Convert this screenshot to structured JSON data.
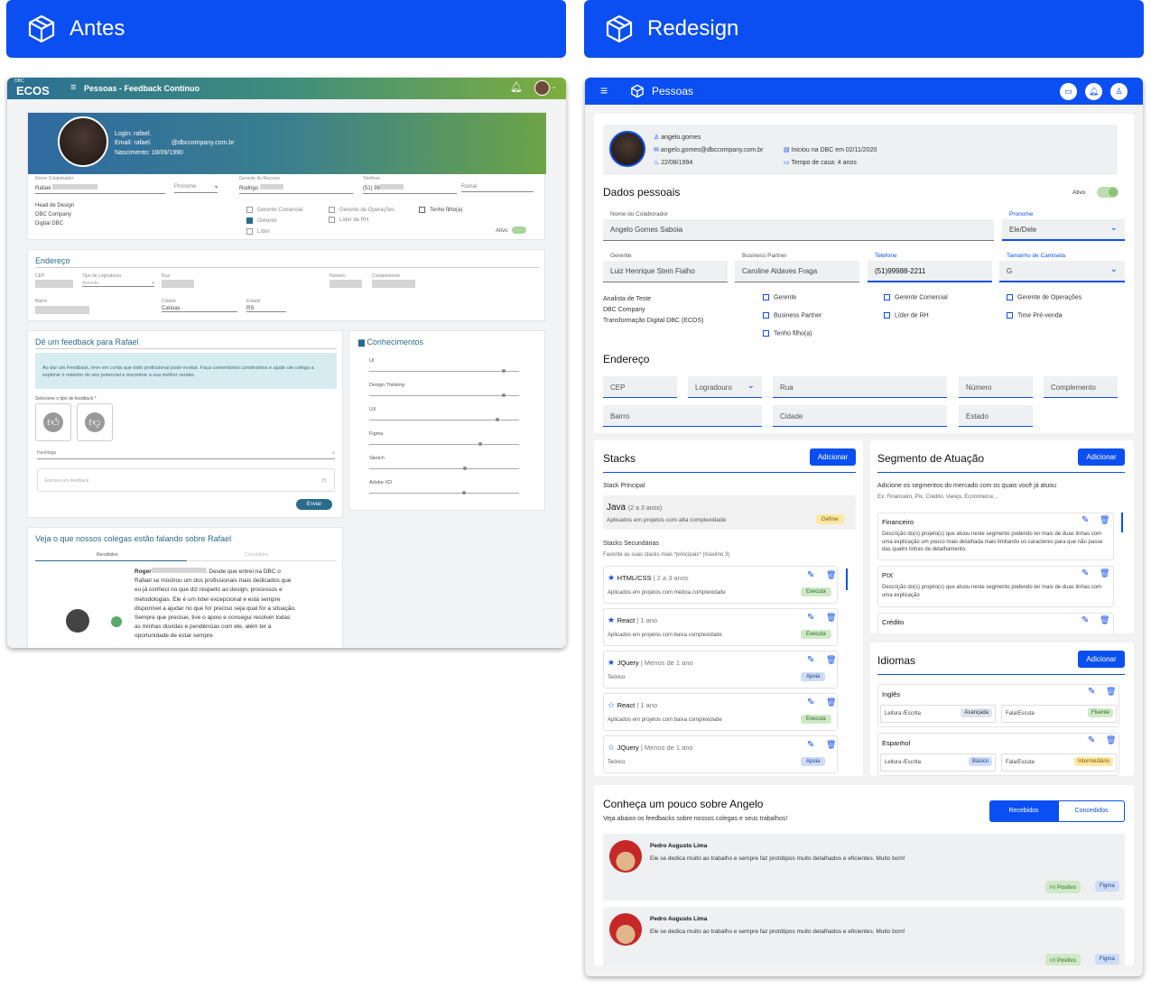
{
  "banner_left": "Antes",
  "banner_right": "Redesign",
  "old": {
    "header_title": "Pessoas - Feedback Contínuo",
    "logo_top": "DBC",
    "logo": "ECOS",
    "login": "Login: rafael.",
    "email": "Email: rafael.",
    "email_end": "@dbccompany.com.br",
    "birth": "Nascimento: 18/09/1990",
    "f_name_lbl": "Nome Colaborador",
    "f_name": "Rafael",
    "f_pron": "Pronome",
    "f_mgr_lbl": "Gerente do Recurso",
    "f_mgr": "Rodrigo",
    "f_tel_lbl": "Telefone",
    "f_tel": "(51) 99",
    "f_ramal": "Ramal",
    "roles": [
      "Head de Design",
      "DBC Company",
      "Digital DBC"
    ],
    "cb1": "Gerente Comercial",
    "cb2": "Gerente",
    "cb3": "Líder",
    "cb4": "Gerente de Operações",
    "cb5": "Líder de RH",
    "cb6": "Tenho filho(a)",
    "ativo": "Ativo",
    "end_title": "Endereço",
    "cep": "CEP",
    "tipo": "Tipo de Logradouro",
    "avenida": "Avenida",
    "rua": "Rua",
    "numero": "Número",
    "compl": "Complemento",
    "bairro": "Bairro",
    "cidade_lbl": "Cidade",
    "cidade": "Canoas",
    "estado_lbl": "Estado",
    "estado": "RS",
    "fb_title": "Dê um feedback para Rafael",
    "fb_info": "Ao dar um Feedback, leve em conta que todo profissional pode evoluir. Faça comentários construtivos e ajude um colega a explorar o máximo do seu potencial e encontrar a sua melhor versão.",
    "fb_type": "Selecione o tipo de feedback *",
    "hashtags": "Hashtags",
    "fb_ph": "Escreva um feedback",
    "send": "Enviar",
    "con_title": "Conhecimentos",
    "skills": [
      "UI",
      "Design Thinking",
      "UX",
      "Figma",
      "Sketch",
      "Adobe XD"
    ],
    "col_title": "Veja o que nossos colegas estão falando sobre Rafael",
    "tab_r": "Recebidos",
    "tab_c": "Concedidos",
    "author": "Roger",
    "quote": ": Desde que entrei na DBC o Rafael se mostrou um dos profissionais mais dedicados que eu já conheci no que diz respeito ao design, processos e metodologias. Ele é um líder excepcional e está sempre disponível a ajudar no que for preciso seja qual for a situação. Sempre que precisei, tive o apoio e consegui resolver todas as minhas dúvidas e pendências com ele, além ter a oportunidade de estar sempre"
  },
  "new": {
    "header_title": "Pessoas",
    "user": "angelo.gomes",
    "email": "angelo.gomes@dbccompany.com.br",
    "birth": "22/08/1994",
    "start": "Iniciou na DBC em 02/11/2020",
    "tenure": "Tempo de casa: 4 anos",
    "dp_title": "Dados pessoais",
    "ativo": "Ativo",
    "name_lbl": "Nome do Colaborador",
    "name": "Angelo Gomes Saboia",
    "pron_lbl": "Pronome",
    "pron": "Ele/Dele",
    "mgr_lbl": "Gerente",
    "mgr": "Luiz Henrique Stein Fialho",
    "bp_lbl": "Business Partner",
    "bp": "Caroline Aldaves Fraga",
    "tel_lbl": "Telefone",
    "tel": "(51)99988-2211",
    "shirt_lbl": "Tamanho de Camiseta",
    "shirt": "G",
    "roles": [
      "Analista de Teste",
      "DBC Company",
      "Transformação Digital DBC (ECOS)"
    ],
    "cbs": [
      "Gerente",
      "Gerente Comercial",
      "Gerente de Operações",
      "Business Partner",
      "Líder de RH",
      "Time Pré-venda",
      "Tenho filho(a)"
    ],
    "end_title": "Endereço",
    "cep": "CEP",
    "logr": "Logradouro",
    "rua": "Rua",
    "numero": "Número",
    "compl": "Complemento",
    "bairro": "Bairro",
    "cidade": "Cidade",
    "estado": "Estado",
    "stacks_title": "Stacks",
    "add": "Adicionar",
    "stack_main": "Stack Principal",
    "java": "Java",
    "java_time": "(2 a 3 anos)",
    "java_desc": "Aplicados em projetos com alta complexidade",
    "define": "Define",
    "stack_sec": "Stacks Secundárias",
    "stack_sec_sub": "Favorite as suas stacks mais *principais* (máximo 3)",
    "stacks": [
      {
        "name": "HTML/CSS",
        "time": "2 a 3 anos",
        "desc": "Aplicados em projetos com médoa complexidade",
        "tag": "Executa"
      },
      {
        "name": "React",
        "time": "1 ano",
        "desc": "Aplicados em projetos com baixa complexidade",
        "tag": "Executa"
      },
      {
        "name": "JQuery",
        "time": "Menos de 1 ano",
        "desc": "Teórico",
        "tag": "Apoia"
      },
      {
        "name": "React",
        "time": "1 ano",
        "desc": "Aplicados em projetos com baixa complexidade",
        "tag": "Executa"
      },
      {
        "name": "JQuery",
        "time": "Menos de 1 ano",
        "desc": "Teórico",
        "tag": "Apoia"
      }
    ],
    "seg_title": "Segmento de Atuação",
    "seg_sub": "Adicione os segmentos do mercado com os quais você já atuou",
    "seg_ex": "Ex: Financeiro, Pix, Crédito, Varejo, Ecommerce...",
    "segs": [
      {
        "name": "Financeiro",
        "desc": "Descrição do(s) projeto(s) que atuou neste segmento podendo ter mais de duas linhas com uma explicação um pouco mais detalhada mais limitando os caracteres para que não passe das quatro linhas de detalhamento."
      },
      {
        "name": "PIX",
        "desc": "Descrição do(s) projeto(s) que atuou neste segmento podendo ter mais de duas linhas com uma explicação"
      },
      {
        "name": "Crédito",
        "desc": ""
      }
    ],
    "lang_title": "Idiomas",
    "langs": [
      {
        "name": "Inglês",
        "read": "Leitura /Escrita",
        "read_lvl": "Avançada",
        "speak": "Fala/Escuta",
        "speak_lvl": "Fluente"
      },
      {
        "name": "Espanhol",
        "read": "Leitura /Escrita",
        "read_lvl": "Básico",
        "speak": "Fala/Escuta",
        "speak_lvl": "Intermediário"
      }
    ],
    "fb_title": "Conheça um pouco sobre Angelo",
    "fb_sub": "Veja abaixo os feedbacks sobre nossos colegas e seus trabalhos!",
    "tab_r": "Recebidos",
    "tab_c": "Concedidos",
    "fbs": [
      {
        "author": "Pedro Augusto Lima",
        "text": "Ele se dedica muito ao trabalho e sempre faz protótipos muito detalhados e eficientes. Muito bom!",
        "tag1": "Positivo",
        "tag2": "Figma"
      },
      {
        "author": "Pedro Augusto Lima",
        "text": "Ele se dedica muito ao trabalho e sempre faz protótipos muito detalhados e eficientes. Muito bom!",
        "tag1": "Positivo",
        "tag2": "Figma"
      }
    ]
  }
}
